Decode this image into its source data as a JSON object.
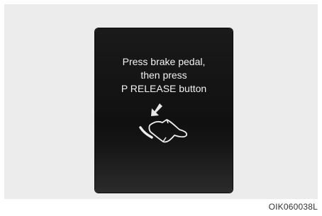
{
  "display": {
    "message_lines": [
      "Press brake pedal,",
      "then press",
      "P RELEASE button"
    ]
  },
  "icons": {
    "pedal": "brake-pedal-press-icon"
  },
  "caption": "OIK060038L"
}
